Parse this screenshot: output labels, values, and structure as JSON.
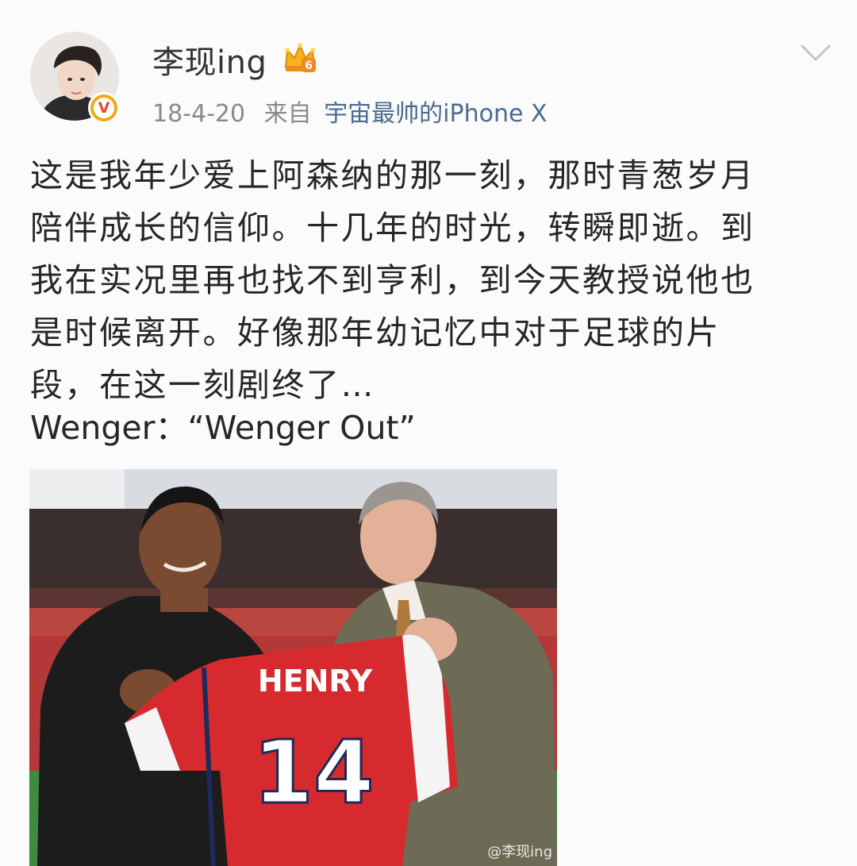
{
  "post": {
    "author": {
      "name": "李现ing",
      "avatar_icon": "avatar-portrait",
      "verified_icon": "verified-v-badge-icon",
      "badge_icon": "crown-icon",
      "verified_badge_text": "V",
      "badge_level_text": "6"
    },
    "menu_icon": "chevron-down-icon",
    "meta": {
      "time": "18-4-20",
      "from_label": "来自",
      "device": "宇宙最帅的iPhone X"
    },
    "text_lines": [
      "这是我年少爱上阿森纳的那一刻，那时青葱岁月",
      "陪伴成长的信仰。十几年的时光，转瞬即逝。到",
      "我在实况里再也找不到亨利，到今天教授说他也",
      "是时候离开。好像那年幼记忆中对于足球的片",
      "段，在这一刻剧终了…"
    ],
    "quote_line": "Wenger：“Wenger Out”",
    "photo": {
      "jersey_name": "HENRY",
      "jersey_number": "14",
      "watermark": "@李现ing"
    },
    "colors": {
      "link": "#4b6a92",
      "meta": "#8a8a8a",
      "text": "#262626",
      "jersey_red": "#d72a2e"
    }
  }
}
